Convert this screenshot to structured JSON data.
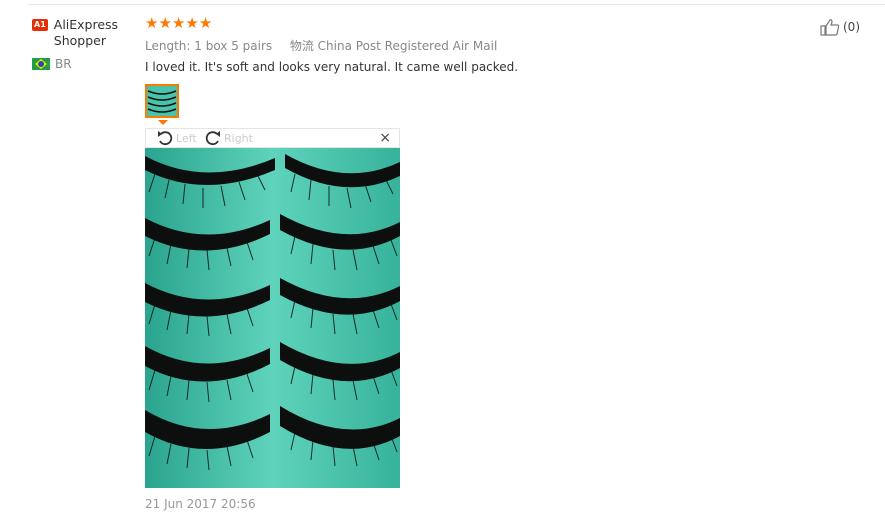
{
  "user": {
    "badge": "A1",
    "name": "AliExpress Shopper",
    "country": "BR"
  },
  "review": {
    "rating": 5,
    "stars": [
      "★",
      "★",
      "★",
      "★",
      "★"
    ],
    "length_label": "Length:",
    "length_value": "1 box 5 pairs",
    "logistics_label": "物流",
    "logistics_value": "China Post Registered Air Mail",
    "text": "I loved it. It's soft and looks very natural. It came well packed.",
    "date": "21 Jun 2017 20:56"
  },
  "viewer": {
    "rotate_left": "Left",
    "rotate_right": "Right",
    "close": "×"
  },
  "like": {
    "count": "(0)"
  },
  "colors": {
    "star": "#ff7900",
    "badge": "#e62e04",
    "photo_bg": "#47c4ac"
  }
}
